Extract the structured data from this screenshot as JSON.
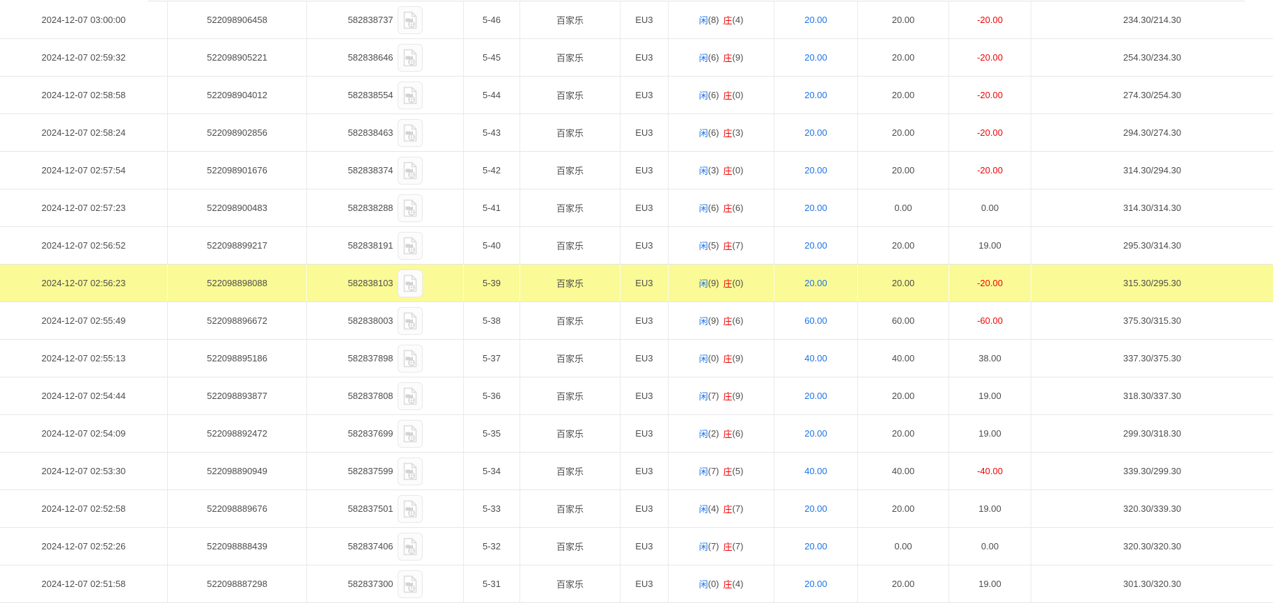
{
  "table": {
    "colors": {
      "accent_blue": "#1a73e8",
      "accent_red": "#f20000",
      "row_highlight": "#fafa96",
      "border": "#e7e7e7"
    },
    "icons": {
      "video_replay": "video-file-icon"
    },
    "rows": [
      {
        "time": "2024-12-07 03:00:00",
        "order_no": "522098906458",
        "round_no": "582838737",
        "table_round": "5-46",
        "game": "百家乐",
        "platform": "EU3",
        "player_label": "闲",
        "player_score": "(8)",
        "banker_label": "庄",
        "banker_score": "(4)",
        "bet_amount": "20.00",
        "valid_amount": "20.00",
        "win_loss": "-20.00",
        "balance": "234.30/214.30",
        "highlighted": false
      },
      {
        "time": "2024-12-07 02:59:32",
        "order_no": "522098905221",
        "round_no": "582838646",
        "table_round": "5-45",
        "game": "百家乐",
        "platform": "EU3",
        "player_label": "闲",
        "player_score": "(6)",
        "banker_label": "庄",
        "banker_score": "(9)",
        "bet_amount": "20.00",
        "valid_amount": "20.00",
        "win_loss": "-20.00",
        "balance": "254.30/234.30",
        "highlighted": false
      },
      {
        "time": "2024-12-07 02:58:58",
        "order_no": "522098904012",
        "round_no": "582838554",
        "table_round": "5-44",
        "game": "百家乐",
        "platform": "EU3",
        "player_label": "闲",
        "player_score": "(6)",
        "banker_label": "庄",
        "banker_score": "(0)",
        "bet_amount": "20.00",
        "valid_amount": "20.00",
        "win_loss": "-20.00",
        "balance": "274.30/254.30",
        "highlighted": false
      },
      {
        "time": "2024-12-07 02:58:24",
        "order_no": "522098902856",
        "round_no": "582838463",
        "table_round": "5-43",
        "game": "百家乐",
        "platform": "EU3",
        "player_label": "闲",
        "player_score": "(6)",
        "banker_label": "庄",
        "banker_score": "(3)",
        "bet_amount": "20.00",
        "valid_amount": "20.00",
        "win_loss": "-20.00",
        "balance": "294.30/274.30",
        "highlighted": false
      },
      {
        "time": "2024-12-07 02:57:54",
        "order_no": "522098901676",
        "round_no": "582838374",
        "table_round": "5-42",
        "game": "百家乐",
        "platform": "EU3",
        "player_label": "闲",
        "player_score": "(3)",
        "banker_label": "庄",
        "banker_score": "(0)",
        "bet_amount": "20.00",
        "valid_amount": "20.00",
        "win_loss": "-20.00",
        "balance": "314.30/294.30",
        "highlighted": false
      },
      {
        "time": "2024-12-07 02:57:23",
        "order_no": "522098900483",
        "round_no": "582838288",
        "table_round": "5-41",
        "game": "百家乐",
        "platform": "EU3",
        "player_label": "闲",
        "player_score": "(6)",
        "banker_label": "庄",
        "banker_score": "(6)",
        "bet_amount": "20.00",
        "valid_amount": "0.00",
        "win_loss": "0.00",
        "balance": "314.30/314.30",
        "highlighted": false
      },
      {
        "time": "2024-12-07 02:56:52",
        "order_no": "522098899217",
        "round_no": "582838191",
        "table_round": "5-40",
        "game": "百家乐",
        "platform": "EU3",
        "player_label": "闲",
        "player_score": "(5)",
        "banker_label": "庄",
        "banker_score": "(7)",
        "bet_amount": "20.00",
        "valid_amount": "20.00",
        "win_loss": "19.00",
        "balance": "295.30/314.30",
        "highlighted": false
      },
      {
        "time": "2024-12-07 02:56:23",
        "order_no": "522098898088",
        "round_no": "582838103",
        "table_round": "5-39",
        "game": "百家乐",
        "platform": "EU3",
        "player_label": "闲",
        "player_score": "(9)",
        "banker_label": "庄",
        "banker_score": "(0)",
        "bet_amount": "20.00",
        "valid_amount": "20.00",
        "win_loss": "-20.00",
        "balance": "315.30/295.30",
        "highlighted": true
      },
      {
        "time": "2024-12-07 02:55:49",
        "order_no": "522098896672",
        "round_no": "582838003",
        "table_round": "5-38",
        "game": "百家乐",
        "platform": "EU3",
        "player_label": "闲",
        "player_score": "(9)",
        "banker_label": "庄",
        "banker_score": "(6)",
        "bet_amount": "60.00",
        "valid_amount": "60.00",
        "win_loss": "-60.00",
        "balance": "375.30/315.30",
        "highlighted": false
      },
      {
        "time": "2024-12-07 02:55:13",
        "order_no": "522098895186",
        "round_no": "582837898",
        "table_round": "5-37",
        "game": "百家乐",
        "platform": "EU3",
        "player_label": "闲",
        "player_score": "(0)",
        "banker_label": "庄",
        "banker_score": "(9)",
        "bet_amount": "40.00",
        "valid_amount": "40.00",
        "win_loss": "38.00",
        "balance": "337.30/375.30",
        "highlighted": false
      },
      {
        "time": "2024-12-07 02:54:44",
        "order_no": "522098893877",
        "round_no": "582837808",
        "table_round": "5-36",
        "game": "百家乐",
        "platform": "EU3",
        "player_label": "闲",
        "player_score": "(7)",
        "banker_label": "庄",
        "banker_score": "(9)",
        "bet_amount": "20.00",
        "valid_amount": "20.00",
        "win_loss": "19.00",
        "balance": "318.30/337.30",
        "highlighted": false
      },
      {
        "time": "2024-12-07 02:54:09",
        "order_no": "522098892472",
        "round_no": "582837699",
        "table_round": "5-35",
        "game": "百家乐",
        "platform": "EU3",
        "player_label": "闲",
        "player_score": "(2)",
        "banker_label": "庄",
        "banker_score": "(6)",
        "bet_amount": "20.00",
        "valid_amount": "20.00",
        "win_loss": "19.00",
        "balance": "299.30/318.30",
        "highlighted": false
      },
      {
        "time": "2024-12-07 02:53:30",
        "order_no": "522098890949",
        "round_no": "582837599",
        "table_round": "5-34",
        "game": "百家乐",
        "platform": "EU3",
        "player_label": "闲",
        "player_score": "(7)",
        "banker_label": "庄",
        "banker_score": "(5)",
        "bet_amount": "40.00",
        "valid_amount": "40.00",
        "win_loss": "-40.00",
        "balance": "339.30/299.30",
        "highlighted": false
      },
      {
        "time": "2024-12-07 02:52:58",
        "order_no": "522098889676",
        "round_no": "582837501",
        "table_round": "5-33",
        "game": "百家乐",
        "platform": "EU3",
        "player_label": "闲",
        "player_score": "(4)",
        "banker_label": "庄",
        "banker_score": "(7)",
        "bet_amount": "20.00",
        "valid_amount": "20.00",
        "win_loss": "19.00",
        "balance": "320.30/339.30",
        "highlighted": false
      },
      {
        "time": "2024-12-07 02:52:26",
        "order_no": "522098888439",
        "round_no": "582837406",
        "table_round": "5-32",
        "game": "百家乐",
        "platform": "EU3",
        "player_label": "闲",
        "player_score": "(7)",
        "banker_label": "庄",
        "banker_score": "(7)",
        "bet_amount": "20.00",
        "valid_amount": "0.00",
        "win_loss": "0.00",
        "balance": "320.30/320.30",
        "highlighted": false
      },
      {
        "time": "2024-12-07 02:51:58",
        "order_no": "522098887298",
        "round_no": "582837300",
        "table_round": "5-31",
        "game": "百家乐",
        "platform": "EU3",
        "player_label": "闲",
        "player_score": "(0)",
        "banker_label": "庄",
        "banker_score": "(4)",
        "bet_amount": "20.00",
        "valid_amount": "20.00",
        "win_loss": "19.00",
        "balance": "301.30/320.30",
        "highlighted": false
      }
    ]
  }
}
